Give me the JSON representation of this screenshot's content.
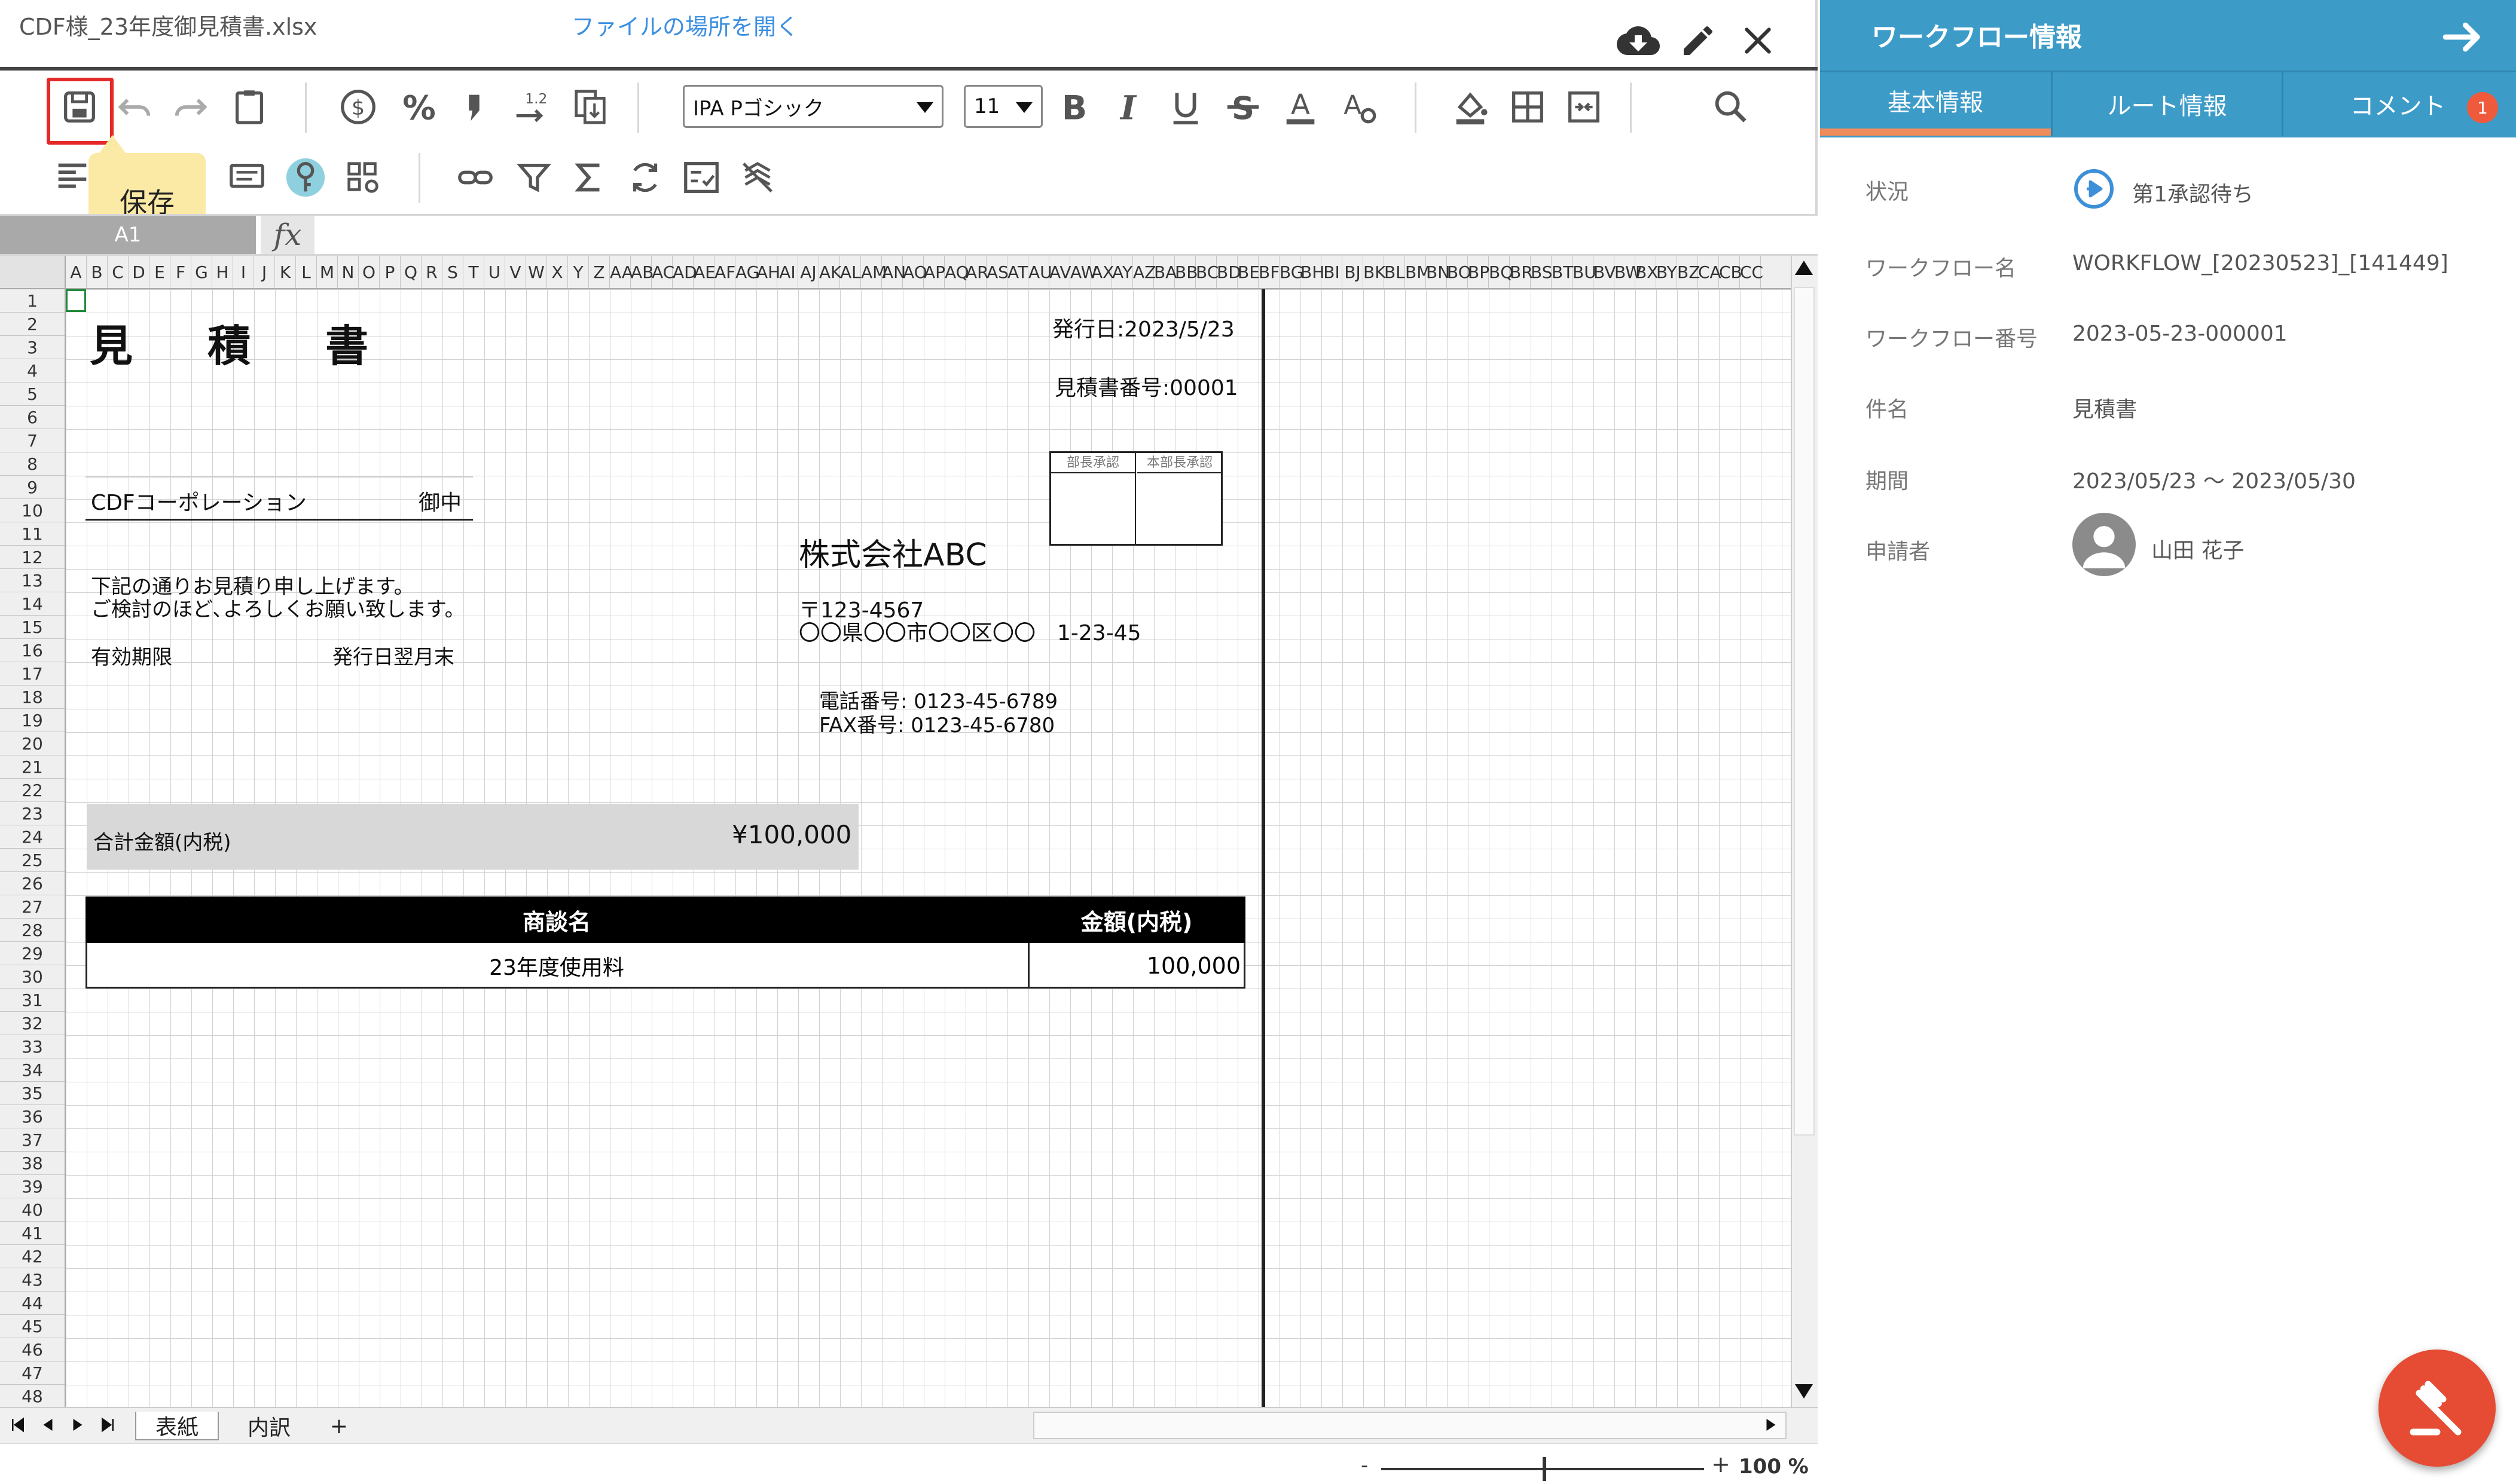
{
  "editor": {
    "file_name": "CDF様_23年度御見積書.xlsx",
    "open_location": "ファイルの場所を開く",
    "tooltip": "保存",
    "font_name": "IPA Pゴシック",
    "font_size": "11",
    "cell_ref": "A1",
    "fx": "fx",
    "columns": [
      "A",
      "B",
      "C",
      "D",
      "E",
      "F",
      "G",
      "H",
      "I",
      "J",
      "K",
      "L",
      "M",
      "N",
      "O",
      "P",
      "Q",
      "R",
      "S",
      "T",
      "U",
      "V",
      "W",
      "X",
      "Y",
      "Z",
      "AA",
      "AB",
      "AC",
      "AD",
      "AE",
      "AF",
      "AG",
      "AH",
      "AI",
      "AJ",
      "AK",
      "AL",
      "AM",
      "AN",
      "AO",
      "AP",
      "AQ",
      "AR",
      "AS",
      "AT",
      "AU",
      "AV",
      "AW",
      "AX",
      "AY",
      "AZ",
      "BA",
      "BB",
      "BC",
      "BD",
      "BE",
      "BF",
      "BG",
      "BH",
      "BI",
      "BJ",
      "BK",
      "BL",
      "BM",
      "BN",
      "BO",
      "BP",
      "BQ",
      "BR",
      "BS",
      "BT",
      "BU",
      "BV",
      "BW",
      "BX",
      "BY",
      "BZ",
      "CA",
      "CB",
      "CC"
    ],
    "rows": [
      "1",
      "2",
      "3",
      "4",
      "5",
      "6",
      "7",
      "8",
      "9",
      "10",
      "11",
      "12",
      "13",
      "14",
      "15",
      "16",
      "17",
      "18",
      "19",
      "20",
      "21",
      "22",
      "23",
      "24",
      "25",
      "26",
      "27",
      "28",
      "29",
      "30",
      "31",
      "32",
      "33",
      "34",
      "35",
      "36",
      "37",
      "38",
      "39",
      "40",
      "41",
      "42",
      "43",
      "44",
      "45",
      "46",
      "47",
      "48"
    ],
    "sheet_tabs": [
      "表紙",
      "内訳"
    ],
    "add_sheet": "+",
    "zoom": {
      "minus": "-",
      "plus": "+",
      "value": "100 %"
    }
  },
  "sheet": {
    "title": "見 積 書",
    "issue_date": "発行日:2023/5/23",
    "quote_no": "見積書番号:00001",
    "approval_headers": [
      "部長承認",
      "本部長承認"
    ],
    "client_name": "CDFコーポレーション",
    "client_suffix": "御中",
    "company": "株式会社ABC",
    "greeting1": "下記の通りお見積り申し上げます。",
    "greeting2": "ご検討のほど､よろしくお願い致します。",
    "zip": "〒123-4567",
    "address": "〇〇県〇〇市〇〇区〇〇　1-23-45",
    "validity_label": "有効期限",
    "validity_value": "発行日翌月末",
    "tel": "電話番号: 0123-45-6789",
    "fax": "FAX番号: 0123-45-6780",
    "total_label": "合計金額(内税)",
    "total_value": "¥100,000",
    "items_header": {
      "name": "商談名",
      "amount": "金額(内税)"
    },
    "items": [
      {
        "name": "23年度使用料",
        "amount": "100,000"
      }
    ]
  },
  "panel": {
    "title": "ワークフロー情報",
    "tabs": [
      {
        "label": "基本情報"
      },
      {
        "label": "ルート情報"
      },
      {
        "label": "コメント"
      }
    ],
    "comment_count": "1",
    "fields": [
      {
        "label": "状況",
        "value": "第1承認待ち"
      },
      {
        "label": "ワークフロー名",
        "value": "WORKFLOW_[20230523]_[141449]"
      },
      {
        "label": "ワークフロー番号",
        "value": "2023-05-23-000001"
      },
      {
        "label": "件名",
        "value": "見積書"
      },
      {
        "label": "期間",
        "value": "2023/05/23 ～ 2023/05/30"
      },
      {
        "label": "申請者",
        "value": "山田 花子"
      }
    ]
  },
  "colors": {
    "accent": "#3d9bc8",
    "tab_underline": "#f08b5a",
    "badge": "#ef5a3c",
    "fab": "#e64b33",
    "highlight": "#e52929",
    "tooltip": "#fbeaa5",
    "link": "#3c8fe0"
  }
}
